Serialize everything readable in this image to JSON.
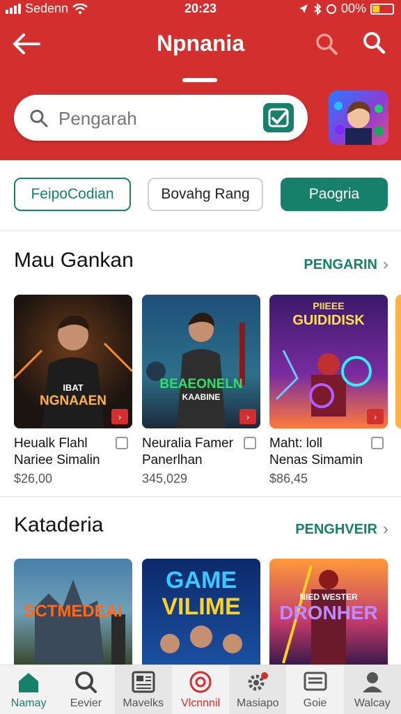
{
  "status": {
    "carrier": "Sedenn",
    "time": "20:23",
    "battery": "00%"
  },
  "appbar": {
    "title": "Npnania"
  },
  "search": {
    "placeholder": "Pengarah"
  },
  "chips": [
    "FeipoCodian",
    "Bovahg Rang",
    "Paogria"
  ],
  "section1": {
    "title": "Mau Gankan",
    "link": "PENGARIN",
    "cards": [
      {
        "line1": "Heualk Flahl",
        "line2": "Nariee Simalin",
        "price": "$26,00",
        "art_title": "IBAT",
        "art_sub": "NGNAAEN",
        "accent": "#ff8a1d"
      },
      {
        "line1": "Neuralia Famer",
        "line2": "Panerlhan",
        "price": "345,029",
        "art_title": "BEAEONELN",
        "art_sub": "KAABINE",
        "accent": "#2fe06a"
      },
      {
        "line1": "Maht: loll",
        "line2": "Nenas Simamin",
        "price": "$86,45",
        "art_title": "PIIEEE",
        "art_sub": "GUIDIDISK",
        "accent": "#ffe14a"
      }
    ]
  },
  "section2": {
    "title": "Kataderia",
    "link": "PENGHVEIR",
    "cards": [
      {
        "art_title": "SCTMEDEAI"
      },
      {
        "art_title": "GAME",
        "art_sub": "VILIME"
      },
      {
        "art_title": "NIED WESTER",
        "art_sub": "DRONHER"
      }
    ]
  },
  "nav": [
    "Namay",
    "Eevier",
    "Mavelks",
    "Vlcnnnil",
    "Masiapo",
    "Goie",
    "Walcay"
  ],
  "colors": {
    "brand_red": "#d32f2f",
    "accent_green": "#17806a"
  }
}
